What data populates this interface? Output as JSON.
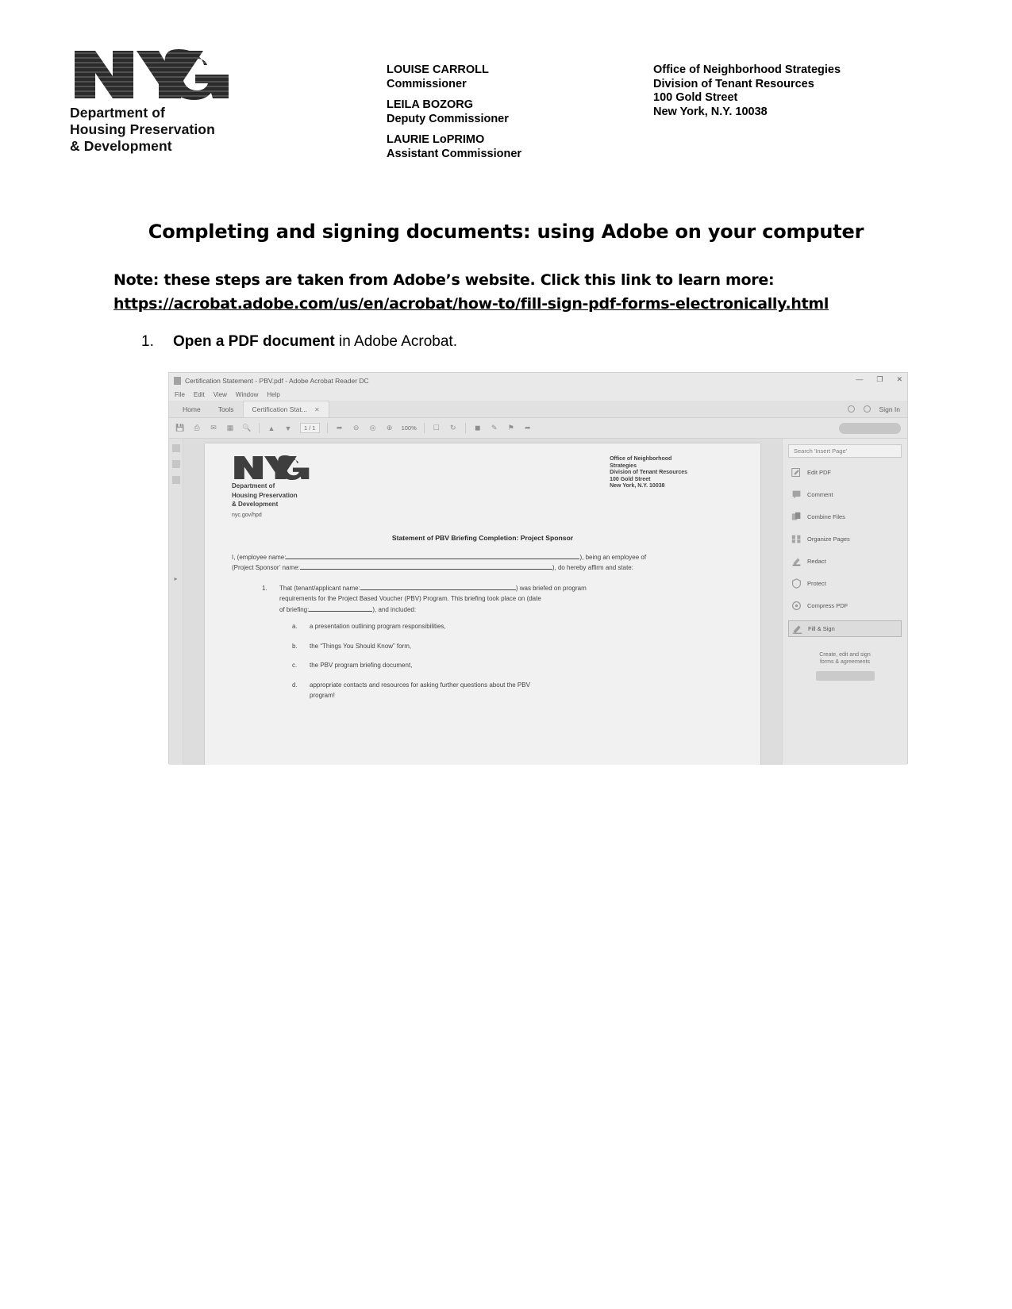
{
  "letterhead": {
    "logo": {
      "mark": "nyc-logo",
      "lines": [
        "Department of",
        "Housing Preservation",
        "& Development"
      ]
    },
    "officers": [
      {
        "name": "LOUISE CARROLL",
        "title": "Commissioner"
      },
      {
        "name": "LEILA BOZORG",
        "title": "Deputy Commissioner"
      },
      {
        "name": "LAURIE LoPRIMO",
        "title": "Assistant Commissioner"
      }
    ],
    "address": [
      "Office of Neighborhood Strategies",
      "Division of Tenant Resources",
      "100 Gold Street",
      "New York, N.Y. 10038"
    ]
  },
  "main": {
    "title": "Completing and signing documents: using Adobe on your computer",
    "note_text": "Note: these steps are taken from Adobe’s website. Click this link to learn more:",
    "note_link": "https://acrobat.adobe.com/us/en/acrobat/how-to/fill-sign-pdf-forms-electronically.html",
    "step": {
      "number": "1.",
      "bold": "Open a PDF document",
      "rest": " in Adobe Acrobat."
    }
  },
  "screenshot": {
    "titlebar": {
      "text": "Certification Statement - PBV.pdf - Adobe Acrobat Reader DC",
      "minimize": "—",
      "maximize": "❐",
      "close": "✕"
    },
    "menubar": [
      "File",
      "Edit",
      "View",
      "Window",
      "Help"
    ],
    "tabs": [
      {
        "label": "Home"
      },
      {
        "label": "Tools"
      },
      {
        "label": "Certification Stat...",
        "close": "✕"
      }
    ],
    "signin": "Sign In",
    "toolbar": {
      "page_value": "1 / 1",
      "zoom_value": "100%",
      "icons": [
        "save-icon",
        "print-icon",
        "email-icon",
        "highlight-icon",
        "search-icon",
        "page-up-icon",
        "page-down-icon",
        "select-tool-icon",
        "zoom-out-icon",
        "zoom-reset-icon",
        "zoom-in-icon",
        "fit-page-icon",
        "rotate-icon",
        "comment-icon",
        "fill-sign-icon",
        "stamp-icon",
        "share-icon"
      ]
    },
    "viewer_document": {
      "logo_lines": [
        "Department of",
        "Housing Preservation",
        "& Development"
      ],
      "website": "nyc.gov/hpd",
      "address": [
        "Office of Neighborhood",
        "Strategies",
        "Division of Tenant Resources",
        "100 Gold Street",
        "New York, N.Y. 10038"
      ],
      "title": "Statement of PBV Briefing Completion: Project Sponsor",
      "intro_1_pre": "I, (employee name:",
      "intro_1_post": "), being an employee of",
      "intro_2_pre": "(Project Sponsor’ name:",
      "intro_2_post": "), do hereby affirm and state:",
      "item1_marker": "1.",
      "item1_pre": "That (tenant/applicant name:",
      "item1_mid": ") was briefed on program",
      "item1_line2": "requirements for the Project Based Voucher (PBV) Program. This briefing took place on (date",
      "item1_line3_pre": "of briefing:",
      "item1_line3_post": "), and included:",
      "subitems": [
        {
          "marker": "a.",
          "text": "a presentation outlining program responsibilities,"
        },
        {
          "marker": "b.",
          "text": "the “Things You Should Know” form,"
        },
        {
          "marker": "c.",
          "text": "the PBV program briefing document,"
        },
        {
          "marker": "d.",
          "text": "appropriate contacts and resources for asking further questions about the PBV"
        },
        {
          "marker": "",
          "text": "program!"
        }
      ]
    },
    "tools_panel": {
      "search_placeholder": "Search 'Insert Page'",
      "tools": [
        {
          "label": "Edit PDF",
          "icon": "edit-pdf-icon",
          "active": false
        },
        {
          "label": "Comment",
          "icon": "comment-icon",
          "active": false
        },
        {
          "label": "Combine Files",
          "icon": "combine-files-icon",
          "active": false
        },
        {
          "label": "Organize Pages",
          "icon": "organize-pages-icon",
          "active": false
        },
        {
          "label": "Redact",
          "icon": "redact-icon",
          "active": false
        },
        {
          "label": "Protect",
          "icon": "protect-icon",
          "active": false
        },
        {
          "label": "Compress PDF",
          "icon": "compress-pdf-icon",
          "active": false
        },
        {
          "label": "Fill & Sign",
          "icon": "fill-sign-icon",
          "active": true
        }
      ],
      "promo_line1": "Create, edit and sign",
      "promo_line2": "forms & agreements"
    }
  }
}
